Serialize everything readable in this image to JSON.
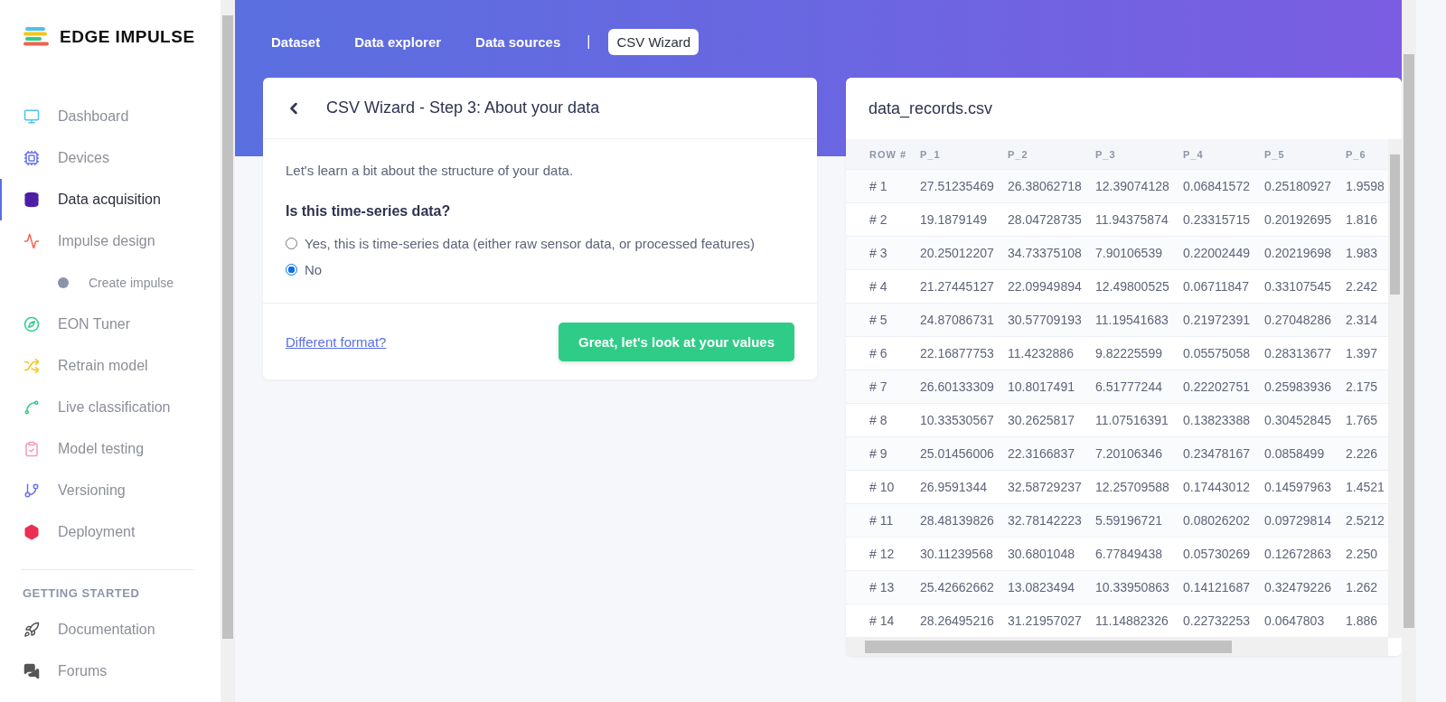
{
  "brand": "EDGE IMPULSE",
  "sidebar": {
    "items": [
      {
        "label": "Dashboard",
        "selected": false
      },
      {
        "label": "Devices",
        "selected": false
      },
      {
        "label": "Data acquisition",
        "selected": true
      },
      {
        "label": "Impulse design",
        "selected": false,
        "children": [
          {
            "label": "Create impulse",
            "selected": false
          }
        ]
      },
      {
        "label": "EON Tuner",
        "selected": false
      },
      {
        "label": "Retrain model",
        "selected": false
      },
      {
        "label": "Live classification",
        "selected": false
      },
      {
        "label": "Model testing",
        "selected": false
      },
      {
        "label": "Versioning",
        "selected": false
      },
      {
        "label": "Deployment",
        "selected": false
      }
    ],
    "section_title": "GETTING STARTED",
    "help_items": [
      {
        "label": "Documentation"
      },
      {
        "label": "Forums"
      }
    ]
  },
  "tabs": [
    {
      "label": "Dataset",
      "selected": false
    },
    {
      "label": "Data explorer",
      "selected": false
    },
    {
      "label": "Data sources",
      "selected": false
    },
    {
      "label": "CSV Wizard",
      "selected": true
    }
  ],
  "tab_separator": "|",
  "wizard": {
    "title": "CSV Wizard - Step 3: About your data",
    "intro": "Let's learn a bit about the structure of your data.",
    "question": "Is this time-series data?",
    "options": [
      {
        "label": "Yes, this is time-series data (either raw sensor data, or processed features)",
        "selected": false
      },
      {
        "label": "No",
        "selected": true
      }
    ],
    "link": "Different format?",
    "button": "Great, let's look at your values"
  },
  "file": {
    "title": "data_records.csv",
    "columns": [
      "ROW #",
      "P_1",
      "P_2",
      "P_3",
      "P_4",
      "P_5",
      "P_6"
    ],
    "rows": [
      [
        "# 1",
        "27.51235469",
        "26.38062718",
        "12.39074128",
        "0.06841572",
        "0.25180927",
        "1.9598"
      ],
      [
        "# 2",
        "19.1879149",
        "28.04728735",
        "11.94375874",
        "0.23315715",
        "0.20192695",
        "1.816"
      ],
      [
        "# 3",
        "20.25012207",
        "34.73375108",
        "7.90106539",
        "0.22002449",
        "0.20219698",
        "1.983"
      ],
      [
        "# 4",
        "21.27445127",
        "22.09949894",
        "12.49800525",
        "0.06711847",
        "0.33107545",
        "2.242"
      ],
      [
        "# 5",
        "24.87086731",
        "30.57709193",
        "11.19541683",
        "0.21972391",
        "0.27048286",
        "2.314"
      ],
      [
        "# 6",
        "22.16877753",
        "11.4232886",
        "9.82225599",
        "0.05575058",
        "0.28313677",
        "1.397"
      ],
      [
        "# 7",
        "26.60133309",
        "10.8017491",
        "6.51777244",
        "0.22202751",
        "0.25983936",
        "2.175"
      ],
      [
        "# 8",
        "10.33530567",
        "30.2625817",
        "11.07516391",
        "0.13823388",
        "0.30452845",
        "1.765"
      ],
      [
        "# 9",
        "25.01456006",
        "22.3166837",
        "7.20106346",
        "0.23478167",
        "0.0858499",
        "2.226"
      ],
      [
        "# 10",
        "26.9591344",
        "32.58729237",
        "12.25709588",
        "0.17443012",
        "0.14597963",
        "1.4521"
      ],
      [
        "# 11",
        "28.48139826",
        "32.78142223",
        "5.59196721",
        "0.08026202",
        "0.09729814",
        "2.5212"
      ],
      [
        "# 12",
        "30.11239568",
        "30.6801048",
        "6.77849438",
        "0.05730269",
        "0.12672863",
        "2.250"
      ],
      [
        "# 13",
        "25.42662662",
        "13.0823494",
        "10.33950863",
        "0.14121687",
        "0.32479226",
        "1.262"
      ],
      [
        "# 14",
        "28.26495216",
        "31.21957027",
        "11.14882326",
        "0.22732253",
        "0.0647803",
        "1.886"
      ]
    ]
  }
}
